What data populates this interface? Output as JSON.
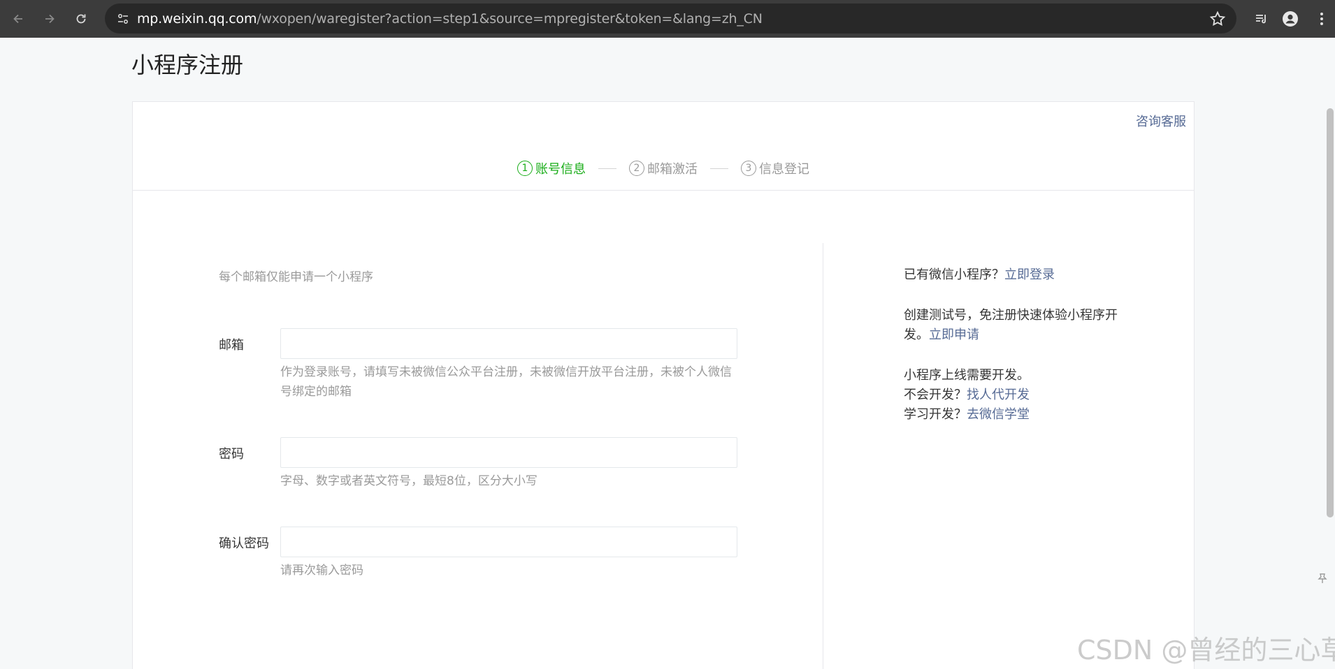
{
  "browser": {
    "url_host": "mp.weixin.qq.com",
    "url_path": "/wxopen/waregister?action=step1&source=mpregister&token=&lang=zh_CN",
    "icons": [
      "back-icon",
      "forward-icon",
      "reload-icon",
      "site-info-icon",
      "bookmark-star-icon",
      "reading-list-icon",
      "profile-icon",
      "more-icon"
    ]
  },
  "page": {
    "title": "小程序注册",
    "consult_link": "咨询客服"
  },
  "steps": [
    {
      "num": "1",
      "label": "账号信息",
      "active": true
    },
    {
      "num": "2",
      "label": "邮箱激活",
      "active": false
    },
    {
      "num": "3",
      "label": "信息登记",
      "active": false
    }
  ],
  "form": {
    "tip": "每个邮箱仅能申请一个小程序",
    "email": {
      "label": "邮箱",
      "value": "",
      "hint": "作为登录账号，请填写未被微信公众平台注册，未被微信开放平台注册，未被个人微信号绑定的邮箱"
    },
    "password": {
      "label": "密码",
      "value": "",
      "hint": "字母、数字或者英文符号，最短8位，区分大小写"
    },
    "confirm": {
      "label": "确认密码",
      "value": "",
      "hint": "请再次输入密码"
    }
  },
  "sidebar": {
    "login_prefix": "已有微信小程序？",
    "login_link": "立即登录",
    "test_text": "创建测试号，免注册快速体验小程序开发。",
    "test_link": "立即申请",
    "dev_line": "小程序上线需要开发。",
    "find_prefix": "不会开发？",
    "find_link": "找人代开发",
    "learn_prefix": "学习开发？",
    "learn_link": "去微信学堂"
  },
  "watermark": "CSDN @曾经的三心草",
  "colors": {
    "accent_green": "#1aad19",
    "link_blue": "#576b95",
    "muted": "#9a9a9a"
  }
}
